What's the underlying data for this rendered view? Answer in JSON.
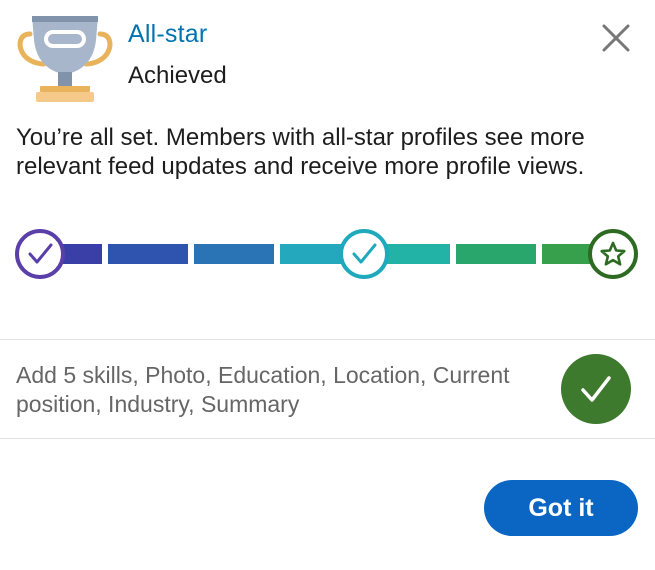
{
  "header": {
    "title": "All-star",
    "status": "Achieved",
    "icon": "trophy-icon",
    "close_icon": "close-icon"
  },
  "message": "You’re all set. Members with all-star profiles see more relevant feed updates and receive more profile views.",
  "progress": {
    "milestones": [
      {
        "icon": "check-icon",
        "completed": true
      },
      {
        "icon": "check-icon",
        "completed": true
      },
      {
        "icon": "star-icon",
        "completed": true
      }
    ],
    "segment_colors": [
      "#3a3fa8",
      "#2f54b0",
      "#2a73b5",
      "#23a8bd",
      "#22b3a6",
      "#28a66c",
      "#36a04c"
    ]
  },
  "requirements": {
    "text": "Add 5 skills, Photo, Education, Location, Current position, Industry, Summary",
    "icon": "check-icon",
    "completed": true
  },
  "actions": {
    "got_it_label": "Got it"
  },
  "colors": {
    "title": "#0073b1",
    "button": "#0a66c2",
    "completed_green": "#3e7a2e"
  }
}
